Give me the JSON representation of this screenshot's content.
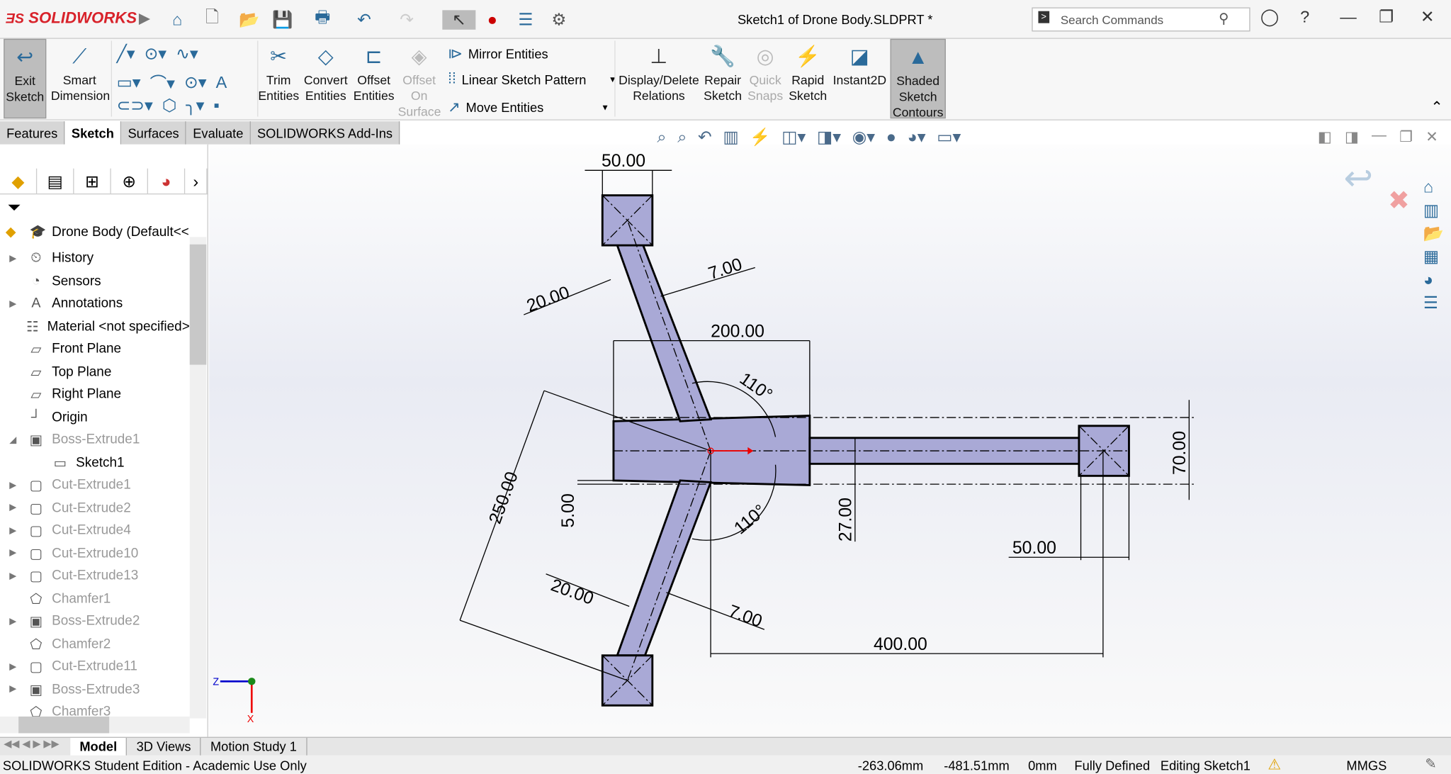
{
  "app": {
    "logo": "SOLIDWORKS",
    "title": "Sketch1 of Drone Body.SLDPRT *",
    "search_placeholder": "Search Commands"
  },
  "ribbon": {
    "exit_sketch": "Exit Sketch",
    "smart_dimension": "Smart Dimension",
    "trim": "Trim Entities",
    "convert": "Convert Entities",
    "offset": "Offset Entities",
    "offset_surface": "Offset On Surface",
    "mirror": "Mirror Entities",
    "linear_pattern": "Linear Sketch Pattern",
    "move": "Move Entities",
    "display_relations": "Display/Delete Relations",
    "repair": "Repair Sketch",
    "quick_snaps": "Quick Snaps",
    "rapid": "Rapid Sketch",
    "instant2d": "Instant2D",
    "shaded": "Shaded Sketch Contours"
  },
  "tabs": [
    "Features",
    "Sketch",
    "Surfaces",
    "Evaluate",
    "SOLIDWORKS Add-Ins"
  ],
  "active_tab": "Sketch",
  "tree": {
    "root": "Drone Body  (Default<<",
    "items": [
      {
        "label": "History",
        "icon": "history-icon",
        "expand": true,
        "grey": false
      },
      {
        "label": "Sensors",
        "icon": "sensor-icon",
        "expand": false,
        "grey": false
      },
      {
        "label": "Annotations",
        "icon": "annotation-icon",
        "expand": true,
        "grey": false
      },
      {
        "label": "Material <not specified>",
        "icon": "material-icon",
        "expand": false,
        "grey": false
      },
      {
        "label": "Front Plane",
        "icon": "plane-icon",
        "expand": false,
        "grey": false
      },
      {
        "label": "Top Plane",
        "icon": "plane-icon",
        "expand": false,
        "grey": false
      },
      {
        "label": "Right Plane",
        "icon": "plane-icon",
        "expand": false,
        "grey": false
      },
      {
        "label": "Origin",
        "icon": "origin-icon",
        "expand": false,
        "grey": false
      },
      {
        "label": "Boss-Extrude1",
        "icon": "extrude-icon",
        "expand": true,
        "grey": true,
        "open": true
      },
      {
        "label": "Sketch1",
        "icon": "sketch-icon",
        "expand": false,
        "grey": false,
        "indent": true
      },
      {
        "label": "Cut-Extrude1",
        "icon": "cut-icon",
        "expand": true,
        "grey": true
      },
      {
        "label": "Cut-Extrude2",
        "icon": "cut-icon",
        "expand": true,
        "grey": true
      },
      {
        "label": "Cut-Extrude4",
        "icon": "cut-icon",
        "expand": true,
        "grey": true
      },
      {
        "label": "Cut-Extrude10",
        "icon": "cut-icon",
        "expand": true,
        "grey": true
      },
      {
        "label": "Cut-Extrude13",
        "icon": "cut-icon",
        "expand": true,
        "grey": true
      },
      {
        "label": "Chamfer1",
        "icon": "chamfer-icon",
        "expand": false,
        "grey": true
      },
      {
        "label": "Boss-Extrude2",
        "icon": "extrude-icon",
        "expand": true,
        "grey": true
      },
      {
        "label": "Chamfer2",
        "icon": "chamfer-icon",
        "expand": false,
        "grey": true
      },
      {
        "label": "Cut-Extrude11",
        "icon": "cut-icon",
        "expand": true,
        "grey": true
      },
      {
        "label": "Boss-Extrude3",
        "icon": "extrude-icon",
        "expand": true,
        "grey": true
      },
      {
        "label": "Chamfer3",
        "icon": "chamfer-icon",
        "expand": false,
        "grey": true
      }
    ]
  },
  "dimensions": {
    "top_square": "50.00",
    "arm_width_top": "20.00",
    "arm_thick_top": "7.00",
    "hub_width": "200.00",
    "angle_top": "110°",
    "angle_bottom": "110°",
    "span": "250.00",
    "offset": "5.00",
    "arm_width_bottom": "20.00",
    "arm_thick_bottom": "7.00",
    "right_arm": "27.00",
    "right_square": "50.00",
    "right_height": "70.00",
    "length": "400.00"
  },
  "bottom_tabs": [
    "Model",
    "3D Views",
    "Motion Study 1"
  ],
  "status": {
    "edition": "SOLIDWORKS Student Edition - Academic Use Only",
    "x": "-263.06mm",
    "y": "-481.51mm",
    "z": "0mm",
    "state": "Fully Defined",
    "editing": "Editing Sketch1",
    "units": "MMGS"
  },
  "colors": {
    "sketch_fill": "#a9a9d6",
    "brand": "#d8222a",
    "accent": "#2a6a9a"
  }
}
